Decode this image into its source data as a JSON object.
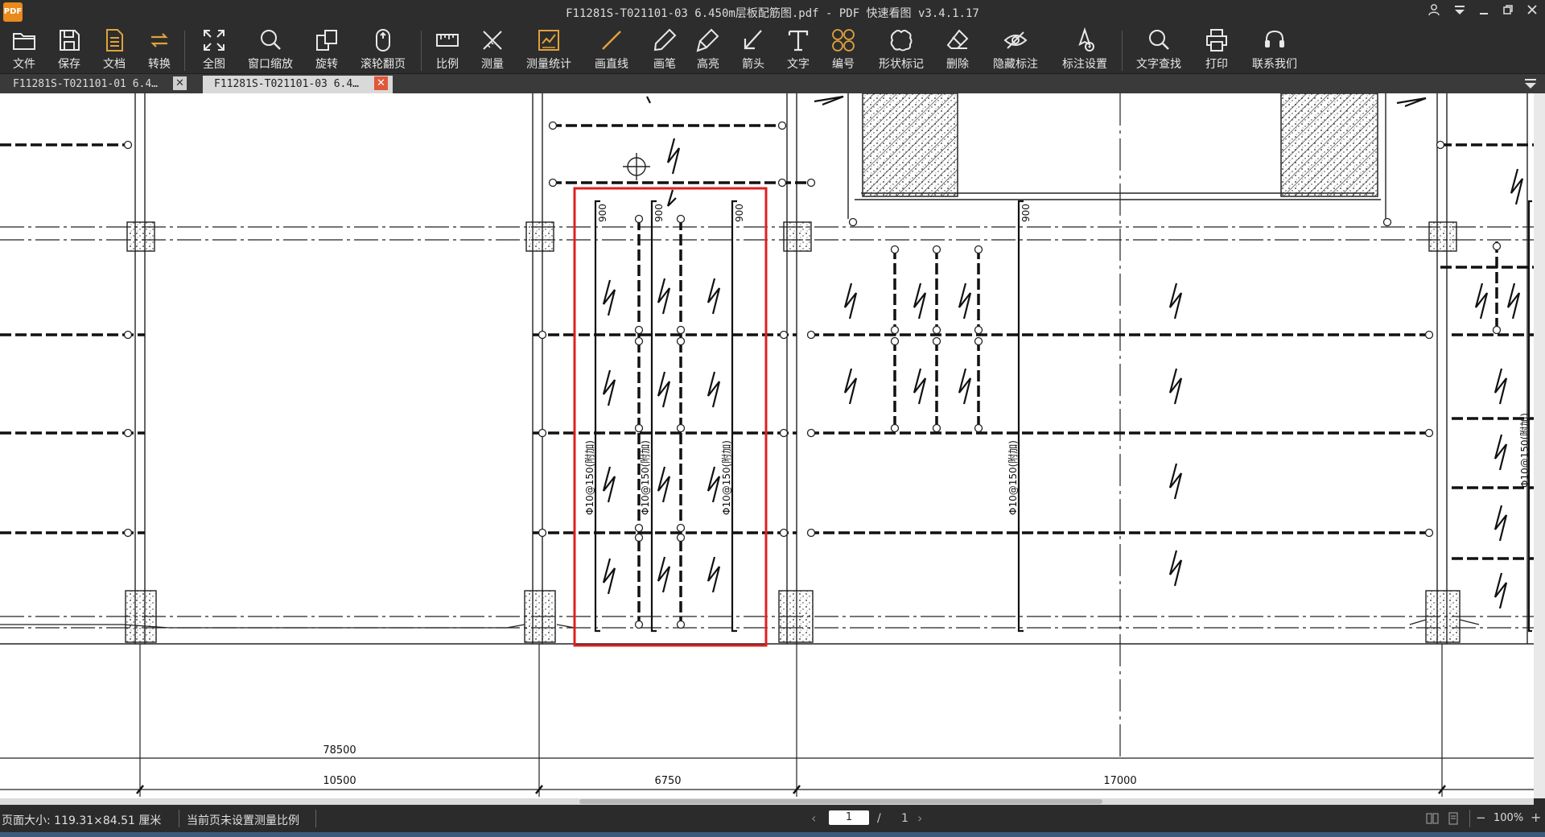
{
  "window": {
    "title": "F11281S-T021101-03 6.450m层板配筋图.pdf - PDF 快速看图 v3.4.1.17",
    "logo_text": "PDF"
  },
  "toolbar": {
    "items": [
      {
        "label": "文件",
        "icon": "folder-icon"
      },
      {
        "label": "保存",
        "icon": "save-icon"
      },
      {
        "label": "文档",
        "icon": "document-icon"
      },
      {
        "label": "转换",
        "icon": "convert-icon"
      },
      {
        "label": "全图",
        "icon": "fit-all-icon"
      },
      {
        "label": "窗口缩放",
        "icon": "zoom-window-icon"
      },
      {
        "label": "旋转",
        "icon": "rotate-icon"
      },
      {
        "label": "滚轮翻页",
        "icon": "mouse-wheel-icon"
      },
      {
        "label": "比例",
        "icon": "scale-ruler-icon"
      },
      {
        "label": "测量",
        "icon": "measure-icon"
      },
      {
        "label": "测量统计",
        "icon": "measure-stats-icon"
      },
      {
        "label": "画直线",
        "icon": "line-icon"
      },
      {
        "label": "画笔",
        "icon": "pen-icon"
      },
      {
        "label": "高亮",
        "icon": "highlighter-icon"
      },
      {
        "label": "箭头",
        "icon": "arrow-icon"
      },
      {
        "label": "文字",
        "icon": "text-icon"
      },
      {
        "label": "编号",
        "icon": "numbering-icon"
      },
      {
        "label": "形状标记",
        "icon": "cloud-shape-icon"
      },
      {
        "label": "删除",
        "icon": "eraser-icon"
      },
      {
        "label": "隐藏标注",
        "icon": "hide-eye-icon"
      },
      {
        "label": "标注设置",
        "icon": "annotation-settings-icon"
      },
      {
        "label": "文字查找",
        "icon": "search-icon"
      },
      {
        "label": "打印",
        "icon": "print-icon"
      },
      {
        "label": "联系我们",
        "icon": "headset-icon"
      }
    ]
  },
  "tabs": [
    {
      "label": "F11281S-T021101-01 6.4…",
      "active": false
    },
    {
      "label": "F11281S-T021101-03 6.4…",
      "active": true
    }
  ],
  "drawing": {
    "rebar_label": "Φ10@150(附加)",
    "len_900": "900",
    "dim_total": "78500",
    "dim_a": "10500",
    "dim_b": "6750",
    "dim_c": "17000"
  },
  "status": {
    "page_size": "页面大小: 119.31×84.51 厘米",
    "scale_note": "当前页未设置测量比例",
    "page_current": "1",
    "page_separator": "/",
    "page_total": "1",
    "zoom": "100%"
  },
  "colors": {
    "accent_orange": "#e0a23a",
    "highlight_red": "#e02020",
    "tab_active_bg": "#d9d9d9",
    "close_red": "#e0583a"
  }
}
